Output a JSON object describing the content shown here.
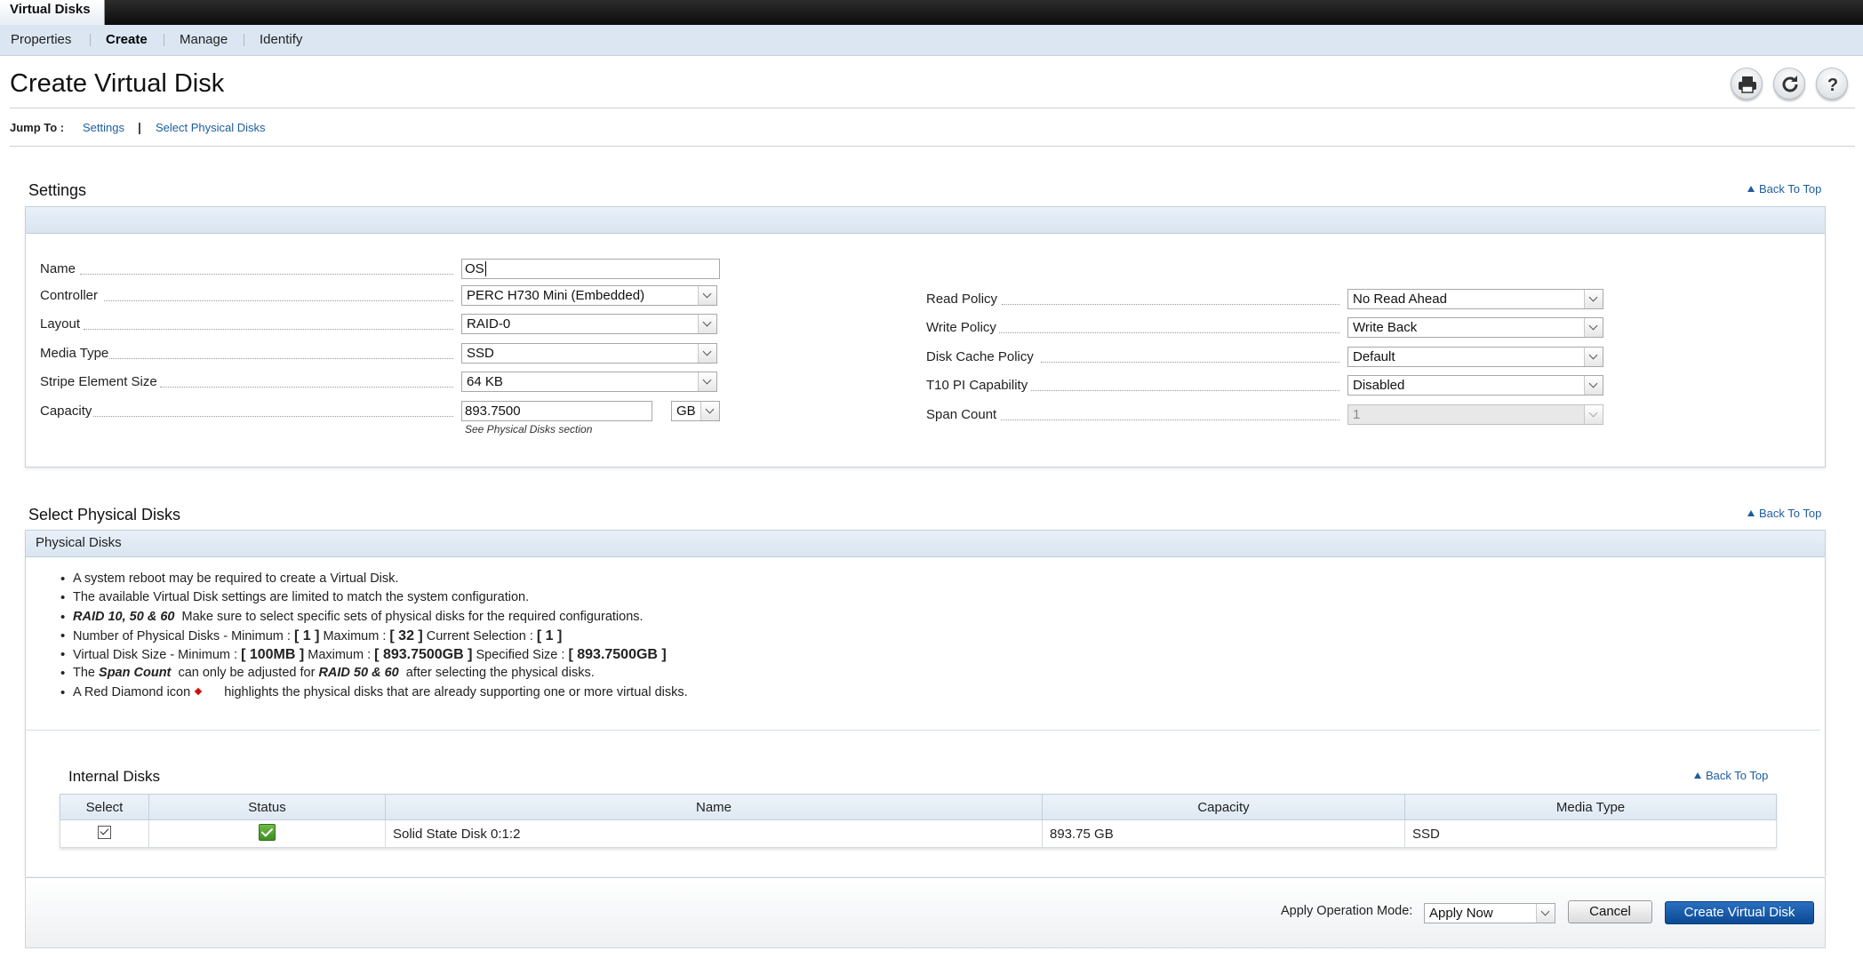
{
  "top_tab": "Virtual Disks",
  "subnav": {
    "items": [
      {
        "label": "Properties"
      },
      {
        "label": "Create"
      },
      {
        "label": "Manage"
      },
      {
        "label": "Identify"
      }
    ]
  },
  "page_title": "Create Virtual Disk",
  "toolbar_icons": [
    "print-icon",
    "refresh-icon",
    "help-icon"
  ],
  "jump": {
    "label": "Jump To :",
    "links": [
      "Settings",
      "Select Physical Disks"
    ],
    "separator": "|"
  },
  "back_to_top": "Back To Top",
  "settings": {
    "title": "Settings",
    "name_label": "Name",
    "name_value": "OS",
    "controller_label": "Controller",
    "controller_value": "PERC H730 Mini (Embedded)",
    "layout_label": "Layout",
    "layout_value": "RAID-0",
    "media_label": "Media Type",
    "media_value": "SSD",
    "stripe_label": "Stripe Element Size",
    "stripe_value": "64 KB",
    "capacity_label": "Capacity",
    "capacity_value": "893.7500",
    "capacity_unit": "GB",
    "capacity_hint": "See Physical Disks section",
    "read_label": "Read Policy",
    "read_value": "No Read Ahead",
    "write_label": "Write Policy",
    "write_value": "Write Back",
    "cache_label": "Disk Cache Policy",
    "cache_value": "Default",
    "t10_label": "T10 PI Capability",
    "t10_value": "Disabled",
    "span_label": "Span Count",
    "span_value": "1"
  },
  "physical": {
    "title": "Select Physical Disks",
    "panel_head": "Physical Disks",
    "b1": "A system reboot may be required to create a Virtual Disk.",
    "b2": "The available Virtual Disk settings are limited to match the system configuration.",
    "b3_bold": "RAID 10, 50 & 60",
    "b3_rest": "Make sure to select specific sets of physical disks for the required configurations.",
    "b4_a": "Number of Physical Disks - Minimum :",
    "b4_min": "[ 1 ]",
    "b4_b": "Maximum :",
    "b4_max": "[ 32 ]",
    "b4_c": "Current Selection :",
    "b4_cur": "[ 1 ]",
    "b5_a": "Virtual Disk Size - Minimum :",
    "b5_min": "[ 100MB ]",
    "b5_b": "Maximum :",
    "b5_max": "[ 893.7500GB ]",
    "b5_c": "Specified Size :",
    "b5_spec": "[ 893.7500GB ]",
    "b6_a": "The",
    "b6_bold1": "Span Count",
    "b6_b": "can only be adjusted for",
    "b6_bold2": "RAID 50 & 60",
    "b6_c": "after selecting the physical disks.",
    "b7_a": "A Red Diamond icon",
    "b7_b": "highlights the physical disks that are already supporting one or more virtual disks."
  },
  "internal": {
    "title": "Internal Disks",
    "columns": [
      "Select",
      "Status",
      "Name",
      "Capacity",
      "Media Type"
    ],
    "rows": [
      {
        "name": "Solid State Disk 0:1:2",
        "capacity": "893.75 GB",
        "media": "SSD"
      }
    ]
  },
  "footer": {
    "mode_label": "Apply Operation Mode:",
    "mode_value": "Apply Now",
    "cancel": "Cancel",
    "create": "Create Virtual Disk"
  }
}
